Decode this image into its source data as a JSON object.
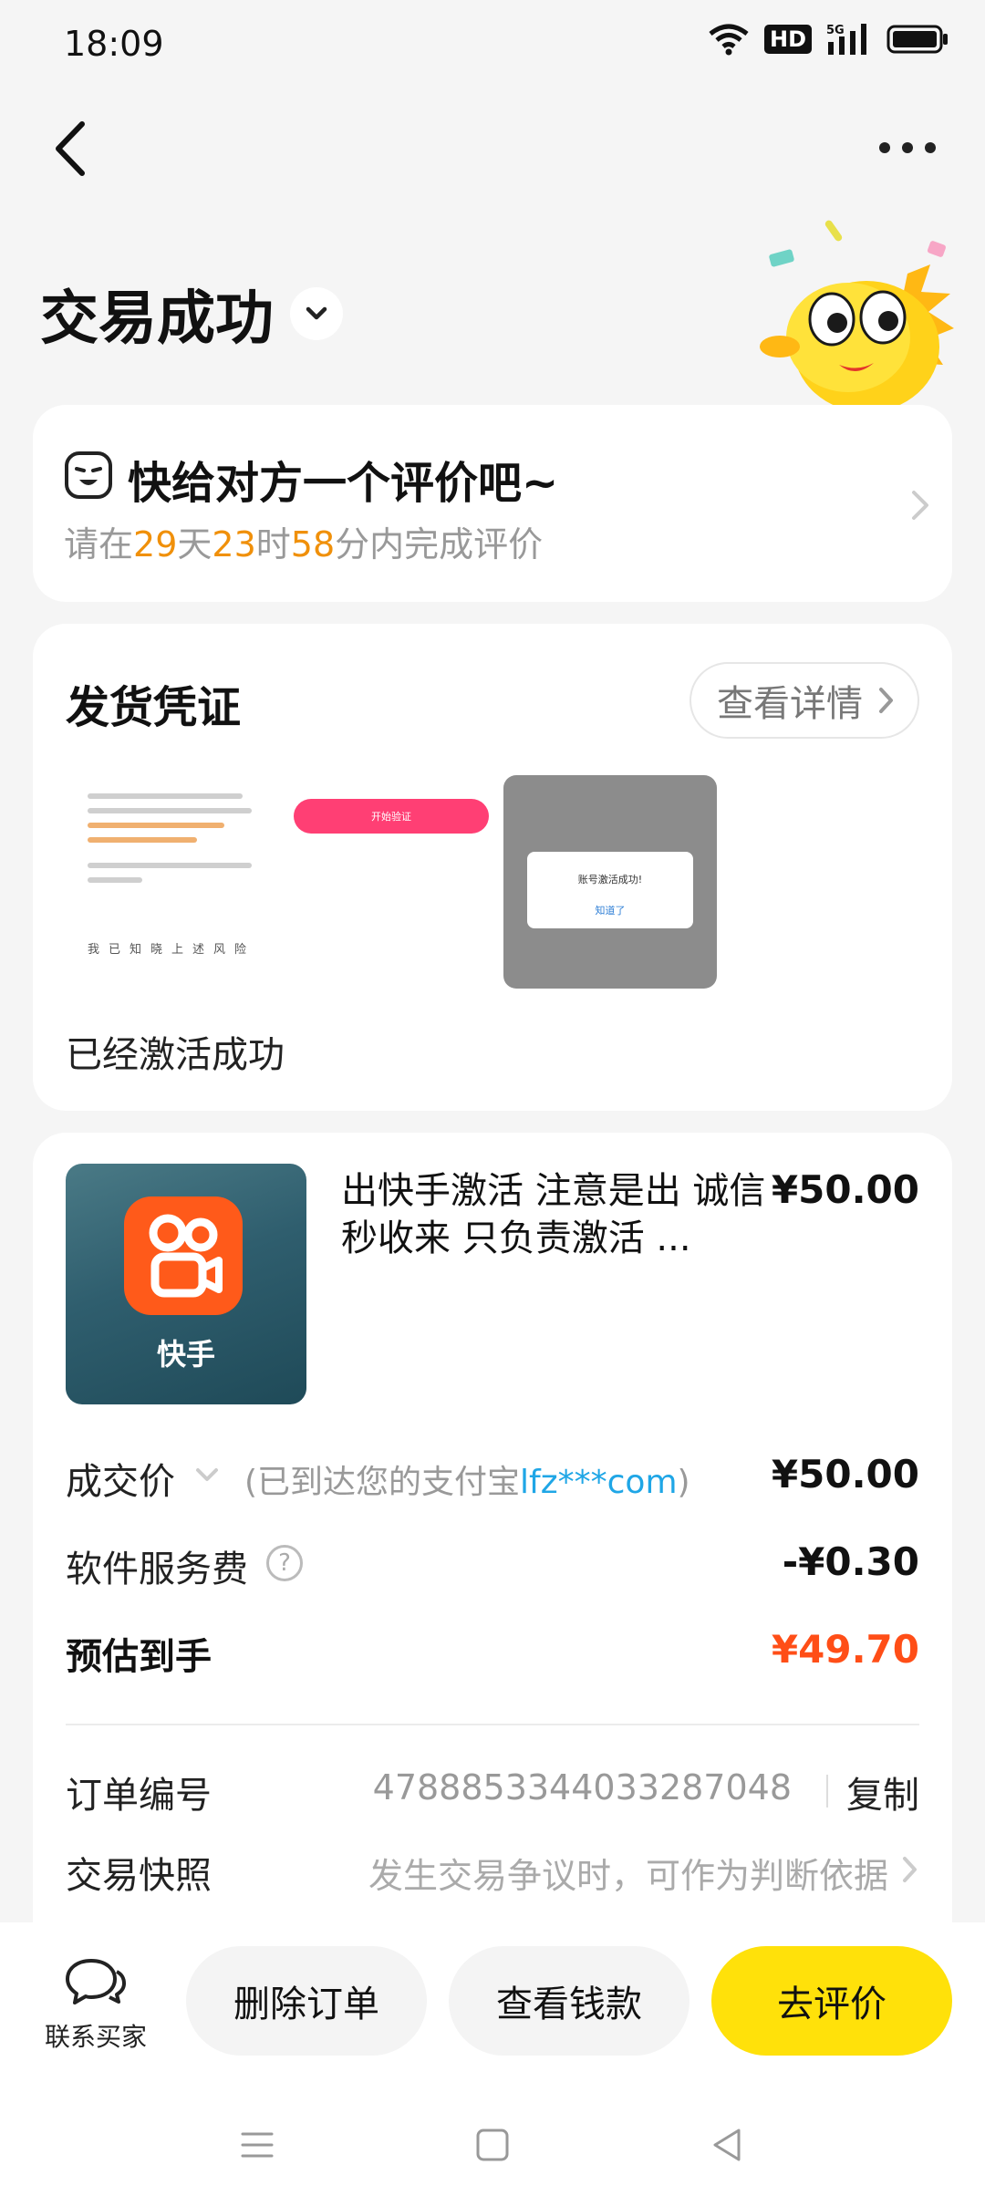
{
  "status_bar": {
    "time": "18:09",
    "hd_label": "HD",
    "net_label": "5G"
  },
  "page": {
    "title": "交易成功"
  },
  "review_card": {
    "title": "快给对方一个评价吧~",
    "prefix": "请在",
    "days": "29",
    "days_unit": "天",
    "hours": "23",
    "hours_unit": "时",
    "minutes": "58",
    "minutes_unit": "分内完成评价"
  },
  "proof_card": {
    "title": "发货凭证",
    "detail_button": "查看详情",
    "thumb_start_button": "开始验证",
    "thumb_dialog_message": "账号激活成功!",
    "thumb_dialog_ok": "知道了",
    "thumb_risk_row": "我已知晓上述风险",
    "note": "已经激活成功"
  },
  "order_card": {
    "product_app_label": "快手",
    "product_title": "出快手激活 注意是出 诚信 秒收来 只负责激活 ...",
    "product_price": "¥50.00",
    "deal_price_label": "成交价",
    "deal_price_note_prefix": "(已到达您的支付宝",
    "deal_price_note_account": "lfz***com",
    "deal_price_note_suffix": ")",
    "deal_price_value": "¥50.00",
    "service_fee_label": "软件服务费",
    "service_fee_value": "-¥0.30",
    "est_label": "预估到手",
    "est_value": "¥49.70",
    "order_no_label": "订单编号",
    "order_no_value": "4788853344033287048",
    "copy_label": "复制",
    "snapshot_label": "交易快照",
    "snapshot_value": "发生交易争议时，可作为判断依据"
  },
  "bottom_bar": {
    "contact_label": "联系买家",
    "delete_label": "删除订单",
    "funds_label": "查看钱款",
    "review_label": "去评价"
  },
  "colors": {
    "accent_yellow": "#ffe10a",
    "countdown_orange": "#f0900a",
    "price_red": "#ff4e17",
    "account_blue": "#1fa6e6"
  }
}
